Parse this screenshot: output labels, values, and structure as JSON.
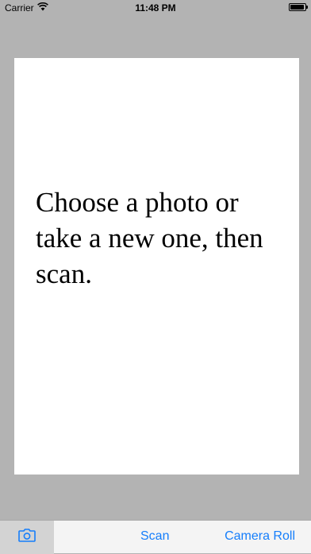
{
  "status_bar": {
    "carrier": "Carrier",
    "time": "11:48 PM",
    "battery_level": 0.95
  },
  "main": {
    "prompt": "Choose a photo or take a new one, then scan."
  },
  "toolbar": {
    "camera_icon": "camera-icon",
    "scan_label": "Scan",
    "camera_roll_label": "Camera Roll"
  },
  "colors": {
    "background": "#b3b3b3",
    "toolbar_tint": "#157efb"
  }
}
